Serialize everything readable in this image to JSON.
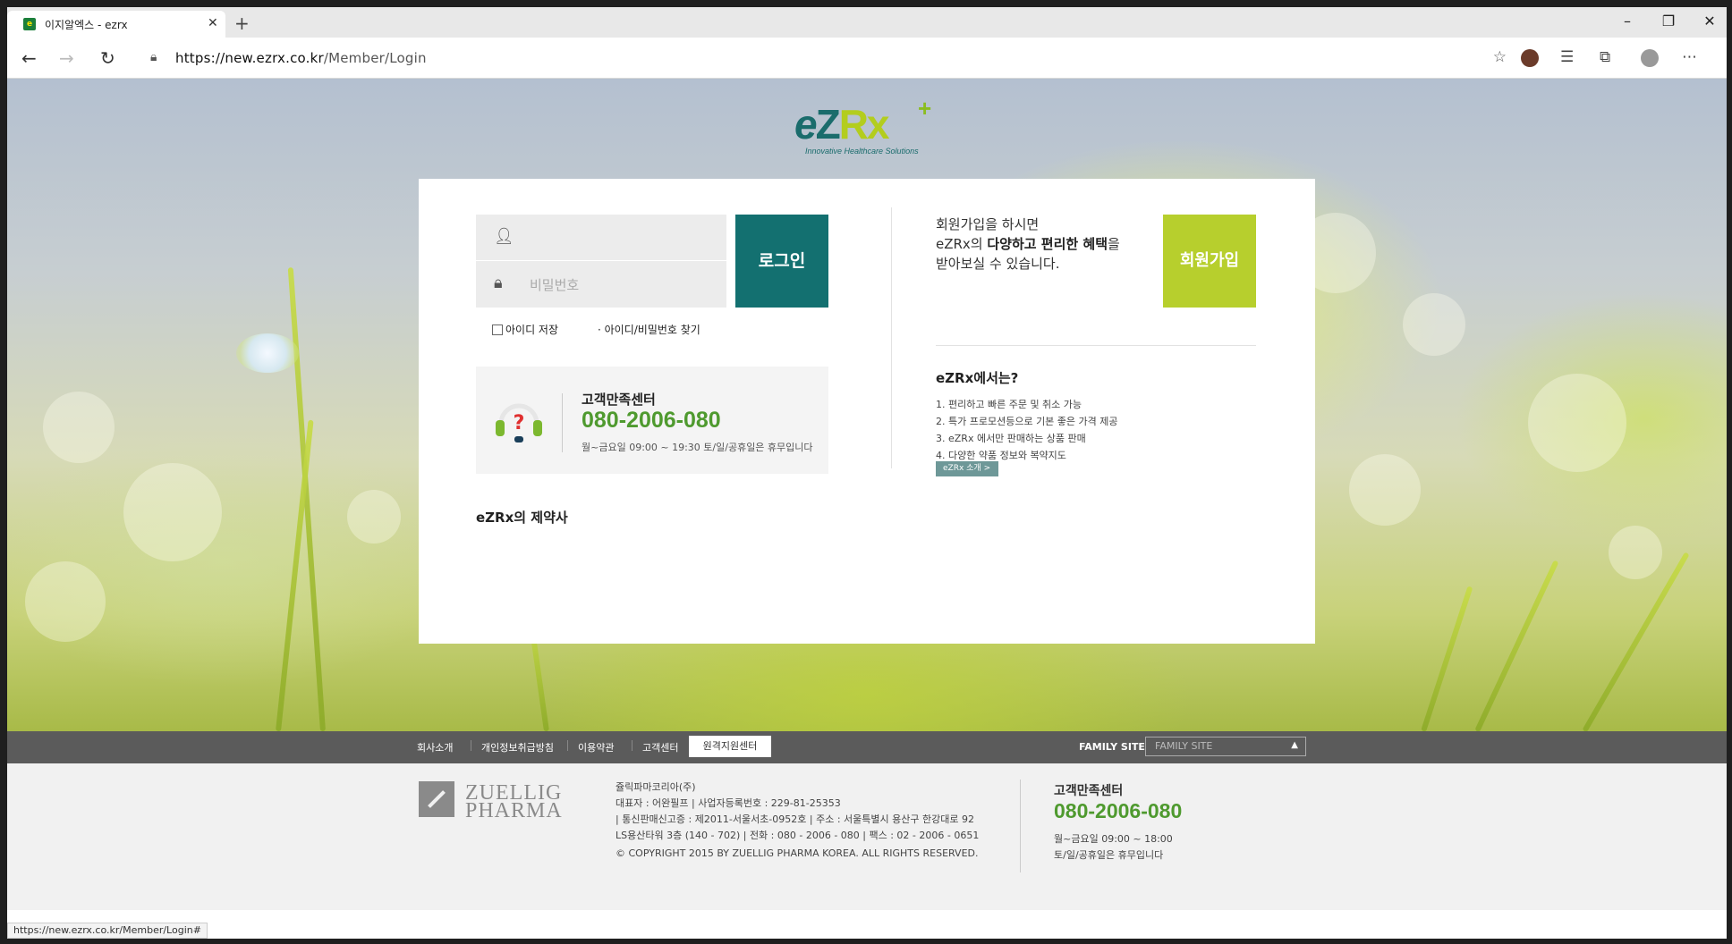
{
  "browser": {
    "tab_title": "이지알엑스 - ezrx",
    "url_base": "https://new.ezrx.co.kr",
    "url_path": "/Member/Login",
    "status_url": "https://new.ezrx.co.kr/Member/Login#"
  },
  "logo": {
    "e": "e",
    "z": "Z",
    "rx": "Rx",
    "plus": "+",
    "tagline": "Innovative Healthcare Solutions"
  },
  "login": {
    "id_placeholder": "",
    "pw_placeholder": "비밀번호",
    "login_button": "로그인",
    "save_id": "아이디 저장",
    "find_link": "· 아이디/비밀번호 찾기"
  },
  "customer_center": {
    "title": "고객만족센터",
    "phone": "080-2006-080",
    "hours": "월~금요일 09:00 ~ 19:30   토/일/공휴일은 휴무입니다"
  },
  "partners_title": "eZRx의 제약사",
  "join": {
    "line1": "회원가입을 하시면",
    "line2_a": "eZRx의 ",
    "line2_b": "다양하고 편리한 혜택",
    "line2_c": "을",
    "line3": "받아보실 수 있습니다.",
    "button": "회원가입"
  },
  "about": {
    "question": "eZRx에서는?",
    "items": [
      "1. 편리하고 빠른 주문 및 취소 가능",
      "2. 특가 프로모션등으로 기본 좋은 가격 제공",
      "3. eZRx 에서만 판매하는 상품 판매",
      "4. 다양한 약품 정보와 복약지도"
    ],
    "button": "eZRx 소개 >"
  },
  "footer_nav": {
    "links": [
      "회사소개",
      "개인정보취급방침",
      "이용약관",
      "고객센터"
    ],
    "remote": "원격지원센터",
    "family_label": "FAMILY SITE",
    "family_select": "FAMILY SITE"
  },
  "footer_info": {
    "zuellig_1": "ZUELLIG",
    "zuellig_2": "PHARMA",
    "lines": [
      "쥴릭파마코리아(주)",
      "대표자 : 어완필프  |  사업자등록번호 : 229-81-25353",
      "| 통신판매신고증 : 제2011-서울서초-0952호 | 주소 : 서울특별시 용산구 한강대로 92",
      "LS용산타워 3층 (140 - 702) | 전화 : 080 - 2006 - 080 | 팩스 : 02 - 2006 - 0651",
      "© COPYRIGHT 2015 BY ZUELLIG PHARMA KOREA. ALL RIGHTS RESERVED."
    ],
    "cs_title": "고객만족센터",
    "cs_phone": "080-2006-080",
    "cs_hours1": "월~금요일 09:00 ~ 18:00",
    "cs_hours2": "토/일/공휴일은 휴무입니다"
  },
  "colors": {
    "brand_teal": "#137070",
    "brand_lime": "#b7cf2d",
    "phone_green": "#4f9a2f"
  }
}
